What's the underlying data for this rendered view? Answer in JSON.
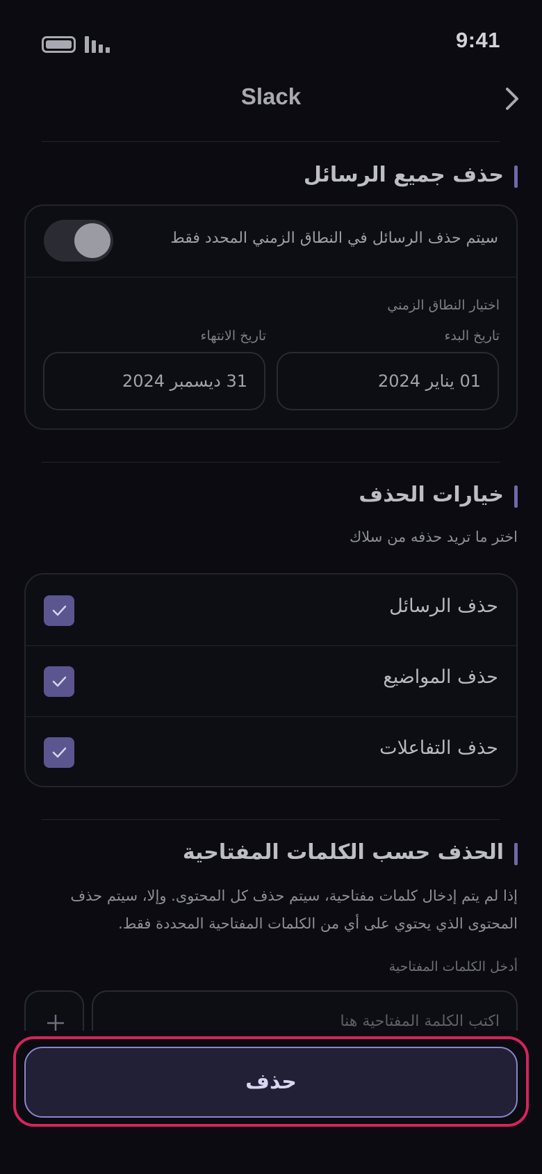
{
  "status_bar": {
    "time": "9:41"
  },
  "header": {
    "title": "Slack"
  },
  "delete_all": {
    "title": "حذف جميع الرسائل",
    "toggle_label": "سيتم حذف الرسائل في النطاق الزمني المحدد فقط",
    "toggle_on": true,
    "range_label": "اختيار النطاق الزمني",
    "start_label": "تاريخ البدء",
    "start_value": "01 يناير 2024",
    "end_label": "تاريخ الانتهاء",
    "end_value": "31 ديسمبر 2024"
  },
  "delete_options": {
    "title": "خيارات الحذف",
    "subtitle": "اختر ما تريد حذفه من سلاك",
    "items": [
      {
        "label": "حذف الرسائل",
        "checked": true
      },
      {
        "label": "حذف المواضيع",
        "checked": true
      },
      {
        "label": "حذف التفاعلات",
        "checked": true
      }
    ]
  },
  "keywords": {
    "title": "الحذف حسب الكلمات المفتاحية",
    "description": "إذا لم يتم إدخال كلمات مفتاحية، سيتم حذف كل المحتوى. وإلا، سيتم حذف المحتوى الذي يحتوي على أي من الكلمات المفتاحية المحددة فقط.",
    "input_label": "أدخل الكلمات المفتاحية",
    "input_placeholder": "اكتب الكلمة المفتاحية هنا"
  },
  "actions": {
    "delete_label": "حذف"
  },
  "colors": {
    "accent": "#8b86cc",
    "highlight": "#d6245a",
    "checkbox": "#5b5690"
  }
}
